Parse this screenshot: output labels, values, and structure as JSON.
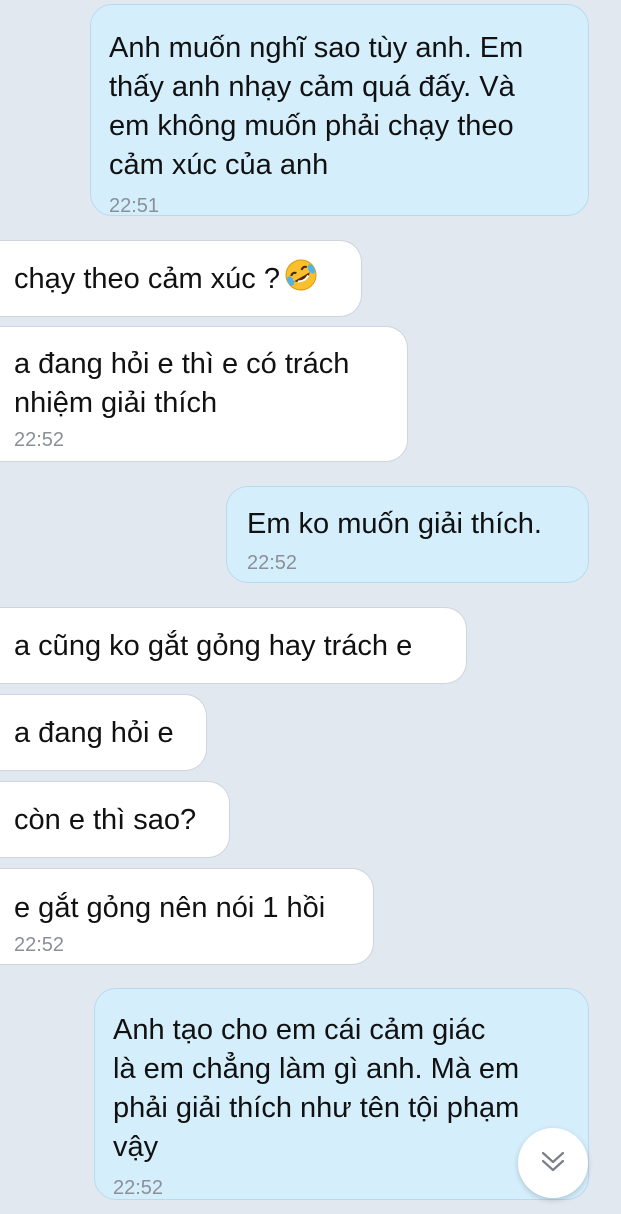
{
  "messages": [
    {
      "side": "sent",
      "text": "Anh muốn nghĩ sao tùy anh. Em\nthấy anh nhạy cảm quá đấy. Và\nem không muốn phải chạy theo\ncảm xúc của anh",
      "time": "22:51"
    },
    {
      "side": "received",
      "text": "chạy theo cảm xúc ?",
      "emoji": "rolling-on-floor-laughing-emoji"
    },
    {
      "side": "received",
      "text": "a đang hỏi e thì e có trách\nnhiệm giải thích",
      "time": "22:52"
    },
    {
      "side": "sent",
      "text": "Em ko muốn giải thích.",
      "time": "22:52"
    },
    {
      "side": "received",
      "text": "a cũng ko gắt gỏng hay trách e"
    },
    {
      "side": "received",
      "text": "a đang hỏi e"
    },
    {
      "side": "received",
      "text": "còn e thì sao?"
    },
    {
      "side": "received",
      "text": "e gắt gỏng nên nói 1 hồi",
      "time": "22:52"
    },
    {
      "side": "sent",
      "text": "Anh tạo cho em cái cảm giác\nlà em chẳng làm gì anh. Mà em\nphải giải thích như tên tội phạm\nvậy",
      "time": "22:52"
    }
  ],
  "scroll_button": {
    "icon": "double-chevron-down-icon"
  },
  "colors": {
    "background": "#e2e8f0",
    "sent_bubble": "#d5eefc",
    "received_bubble": "#ffffff",
    "timestamp": "#8a9097"
  }
}
